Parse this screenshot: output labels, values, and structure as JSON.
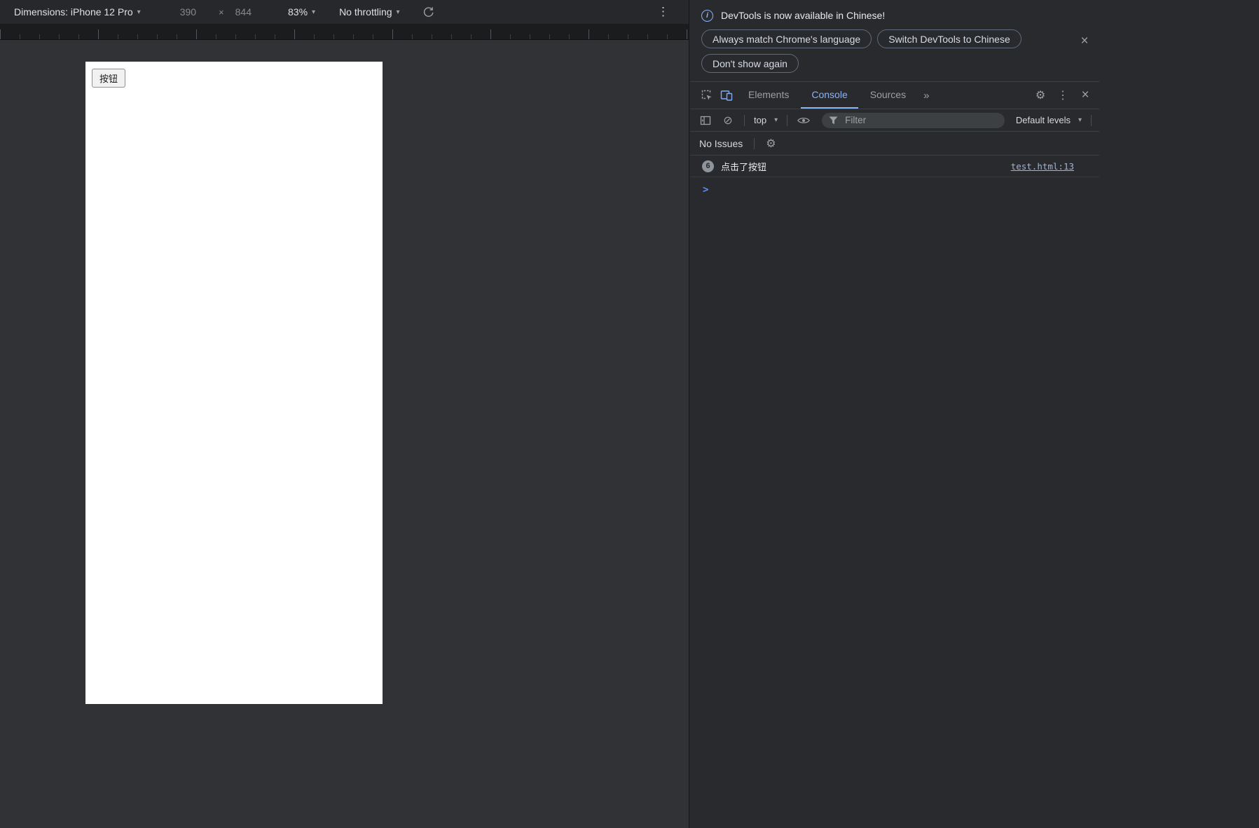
{
  "device_toolbar": {
    "dimensions_label": "Dimensions: iPhone 12 Pro",
    "width_value": "390",
    "height_value": "844",
    "zoom_value": "83%",
    "throttling_value": "No throttling"
  },
  "device_page": {
    "button_label": "按钮"
  },
  "devtools": {
    "infobar": {
      "message": "DevTools is now available in Chinese!",
      "buttons": [
        "Always match Chrome's language",
        "Switch DevTools to Chinese",
        "Don't show again"
      ]
    },
    "tabbar": {
      "tabs": [
        {
          "label": "Elements",
          "active": false
        },
        {
          "label": "Console",
          "active": true
        },
        {
          "label": "Sources",
          "active": false
        }
      ]
    },
    "console_toolbar": {
      "context": "top",
      "filter_placeholder": "Filter",
      "levels": "Default levels"
    },
    "issues_bar": {
      "label": "No Issues"
    },
    "console": {
      "message": {
        "repeat_count": "6",
        "text": "点击了按钮",
        "source": "test.html:13"
      }
    }
  },
  "icons": {
    "caret_down": "▾",
    "multiply": "×",
    "kebab": "⋮",
    "gear": "⚙",
    "close": "×",
    "clear": "⊘",
    "more_tabs": "»",
    "info": "i",
    "prompt": ">"
  },
  "colors": {
    "accent_blue": "#8ab4f8",
    "devtools_background": "#282a2e",
    "canvas_background": "#313236",
    "page_background": "#ffffff",
    "muted_text": "#9aa0a6",
    "link_color": "#a0b4d6"
  }
}
